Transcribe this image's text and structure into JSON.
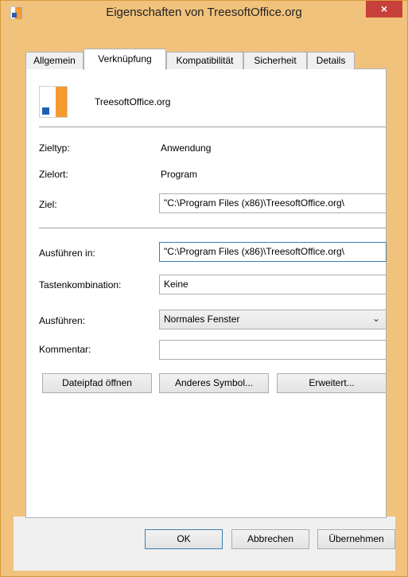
{
  "window": {
    "title": "Eigenschaften von TreesoftOffice.org",
    "close_glyph": "×"
  },
  "tabs": [
    {
      "label": "Allgemein",
      "active": false
    },
    {
      "label": "Verknüpfung",
      "active": true
    },
    {
      "label": "Kompatibilität",
      "active": false
    },
    {
      "label": "Sicherheit",
      "active": false
    },
    {
      "label": "Details",
      "active": false
    }
  ],
  "shortcut": {
    "name": "TreesoftOffice.org",
    "zieltyp_label": "Zieltyp:",
    "zieltyp_value": "Anwendung",
    "zielort_label": "Zielort:",
    "zielort_value": "Program",
    "ziel_label": "Ziel:",
    "ziel_value": "\"C:\\Program Files (x86)\\TreesoftOffice.org\\",
    "ausfuehren_in_label": "Ausführen in:",
    "ausfuehren_in_value": "\"C:\\Program Files (x86)\\TreesoftOffice.org\\",
    "tastenkombination_label": "Tastenkombination:",
    "tastenkombination_value": "Keine",
    "ausfuehren_label": "Ausführen:",
    "ausfuehren_value": "Normales Fenster",
    "kommentar_label": "Kommentar:",
    "kommentar_value": ""
  },
  "buttons": {
    "dateipfad": "Dateipfad öffnen",
    "anderes_symbol": "Anderes Symbol...",
    "erweitert": "Erweitert...",
    "ok": "OK",
    "abbrechen": "Abbrechen",
    "uebernehmen": "Übernehmen"
  },
  "colors": {
    "frame": "#f1c27c",
    "close": "#c7403a",
    "accent": "#3c7fb1",
    "icon_orange": "#f59a2e"
  }
}
